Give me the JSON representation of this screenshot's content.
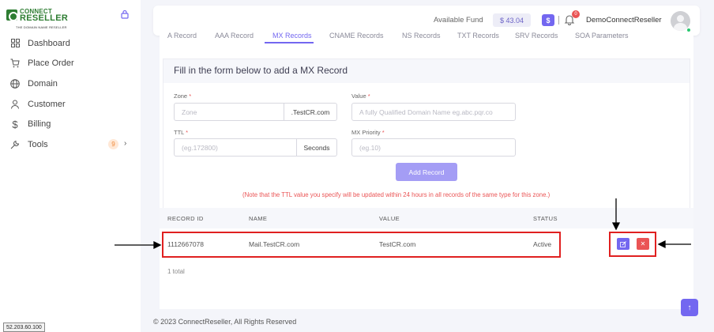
{
  "brand": {
    "line1": "CONNECT",
    "line2": "RESELLER",
    "tagline": "THE DOMAIN NAME RESELLER"
  },
  "sidebar": {
    "items": [
      {
        "label": "Dashboard",
        "icon": "grid-icon"
      },
      {
        "label": "Place Order",
        "icon": "cart-icon"
      },
      {
        "label": "Domain",
        "icon": "globe-icon"
      },
      {
        "label": "Customer",
        "icon": "user-icon"
      },
      {
        "label": "Billing",
        "icon": "dollar-icon"
      },
      {
        "label": "Tools",
        "icon": "wrench-icon",
        "badge": "9"
      }
    ]
  },
  "header": {
    "fund_label": "Available Fund",
    "fund_value": "$ 43.04",
    "dollar_button": "$",
    "notification_count": "0",
    "username": "DemoConnectReseller"
  },
  "tabs": [
    {
      "label": "A Record",
      "active": false
    },
    {
      "label": "AAA Record",
      "active": false
    },
    {
      "label": "MX Records",
      "active": true
    },
    {
      "label": "CNAME Records",
      "active": false
    },
    {
      "label": "NS Records",
      "active": false
    },
    {
      "label": "TXT Records",
      "active": false
    },
    {
      "label": "SRV Records",
      "active": false
    },
    {
      "label": "SOA Parameters",
      "active": false
    }
  ],
  "form": {
    "title": "Fill in the form below to add a MX Record",
    "zone": {
      "label": "Zone",
      "placeholder": "Zone",
      "addon": ".TestCR.com"
    },
    "value": {
      "label": "Value",
      "placeholder": "A fully Qualified Domain Name eg.abc.pqr.co"
    },
    "ttl": {
      "label": "TTL",
      "placeholder": "(eg.172800)",
      "addon": "Seconds"
    },
    "priority": {
      "label": "MX Priority",
      "placeholder": "(eg.10)"
    },
    "submit_label": "Add Record",
    "note": "(Note that the TTL value you specify will be updated within 24 hours in all records of the same type for this zone.)"
  },
  "table": {
    "headers": [
      "RECORD ID",
      "NAME",
      "VALUE",
      "STATUS"
    ],
    "rows": [
      {
        "id": "1112667078",
        "name": "Mail.TestCR.com",
        "value": "TestCR.com",
        "status": "Active"
      }
    ],
    "total": "1 total"
  },
  "footer": "© 2023 ConnectReseller, All Rights Reserved",
  "ip_tag": "52.203.60.100",
  "colors": {
    "accent": "#7367f0",
    "danger": "#ea5455",
    "brand_green": "#2e7d32"
  }
}
